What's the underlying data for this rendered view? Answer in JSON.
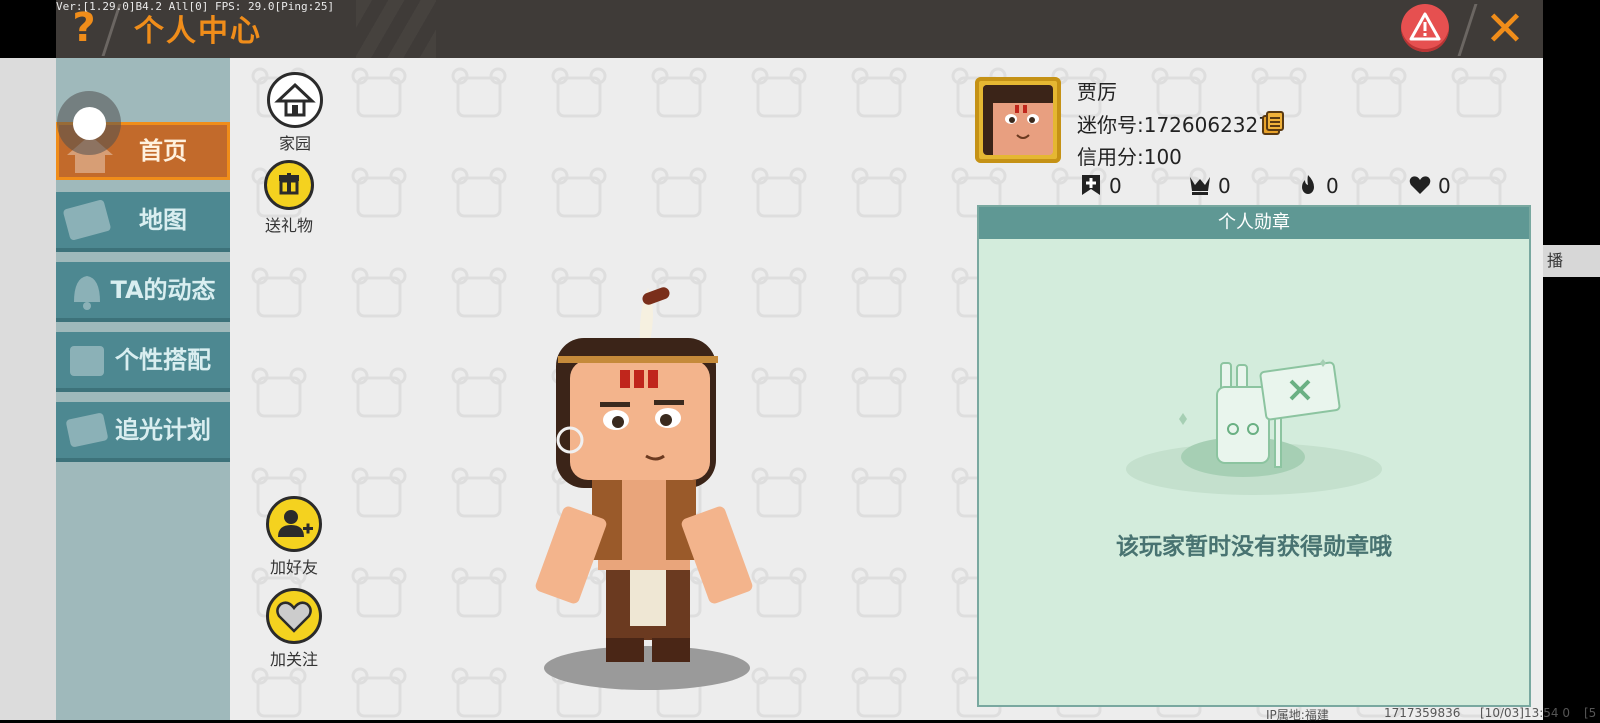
{
  "debug_text": "Ver:[1.29.0]B4.2 All[0] FPS: 29.0[Ping:25]",
  "header": {
    "title": "个人中心",
    "help_icon": "question-mark-icon",
    "help_glyph": "?",
    "warning_icon": "warning-triangle-icon",
    "close_icon": "close-x-icon",
    "close_glyph": "✕"
  },
  "sidebar": {
    "items": [
      {
        "label": "首页",
        "icon": "home-icon",
        "active": true
      },
      {
        "label": "地图",
        "icon": "map-icon",
        "active": false
      },
      {
        "label": "TA的动态",
        "icon": "bell-icon",
        "active": false
      },
      {
        "label": "个性搭配",
        "icon": "outfit-icon",
        "active": false
      },
      {
        "label": "追光计划",
        "icon": "film-icon",
        "active": false
      }
    ]
  },
  "actions": {
    "home": {
      "label": "家园",
      "icon": "house-icon"
    },
    "gift": {
      "label": "送礼物",
      "icon": "gift-icon"
    },
    "add_friend": {
      "label": "加好友",
      "icon": "add-friend-icon"
    },
    "follow": {
      "label": "加关注",
      "icon": "heart-icon"
    }
  },
  "profile": {
    "username": "贾厉",
    "mini_id": "迷你号:1726062327",
    "credit": "信用分:100",
    "stats": [
      {
        "icon": "bookmark-plus-icon",
        "value": "0"
      },
      {
        "icon": "trophy-icon",
        "value": "0"
      },
      {
        "icon": "flame-icon",
        "value": "0"
      },
      {
        "icon": "hearts-icon",
        "value": "0"
      }
    ]
  },
  "medals": {
    "title": "个人勋章",
    "empty_text": "该玩家暂时没有获得勋章哦"
  },
  "right_tab": "播",
  "footer": {
    "ip": "IP属地:福建",
    "number": "1717359836",
    "time": "[10/03]13:54 0",
    "extra": "[5"
  },
  "colors": {
    "accent": "#f08d1a",
    "header_bg": "#3f3b38",
    "sidebar_bg": "#9fb9bb",
    "nav_bg": "#4d8891",
    "active_nav": "#c26a2b",
    "medal_header": "#5f9894",
    "medal_bg": "#d3ecdc"
  }
}
